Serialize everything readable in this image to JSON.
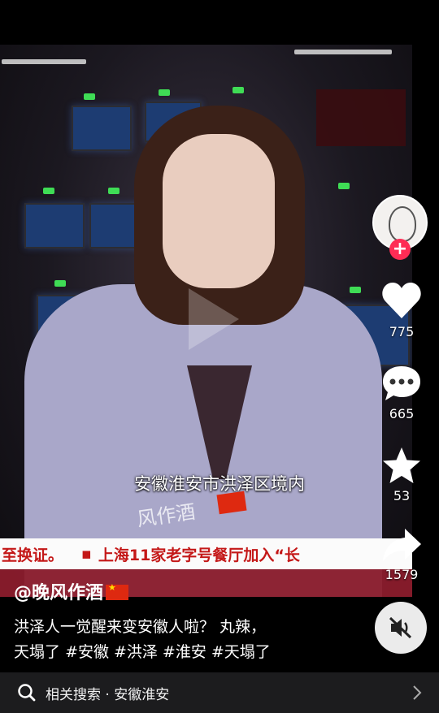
{
  "video": {
    "subtitle": "安徽淮安市洪泽区境内",
    "watermark": "风作酒",
    "ticker_left": "至换证。",
    "ticker_bullet": "▪",
    "ticker_right": "上海11家老字号餐厅加入“",
    "ticker_tail": "长"
  },
  "rail": {
    "likes": "775",
    "comments": "665",
    "favorites": "53",
    "shares": "1579",
    "follow_symbol": "+"
  },
  "caption": {
    "author": "@晚风作酒",
    "text_line1": "洪泽人一觉醒来变安徽人啦？ 丸辣，",
    "text_line2_prefix": "天塌了",
    "tags": [
      "#安徽",
      "#洪泽",
      "#淮安",
      "#天塌了"
    ]
  },
  "related": {
    "label": "相关搜索 · 安徽淮安"
  },
  "colors": {
    "accent": "#fe2c55",
    "ticker_red": "#c41818",
    "flag_red": "#de2910"
  }
}
